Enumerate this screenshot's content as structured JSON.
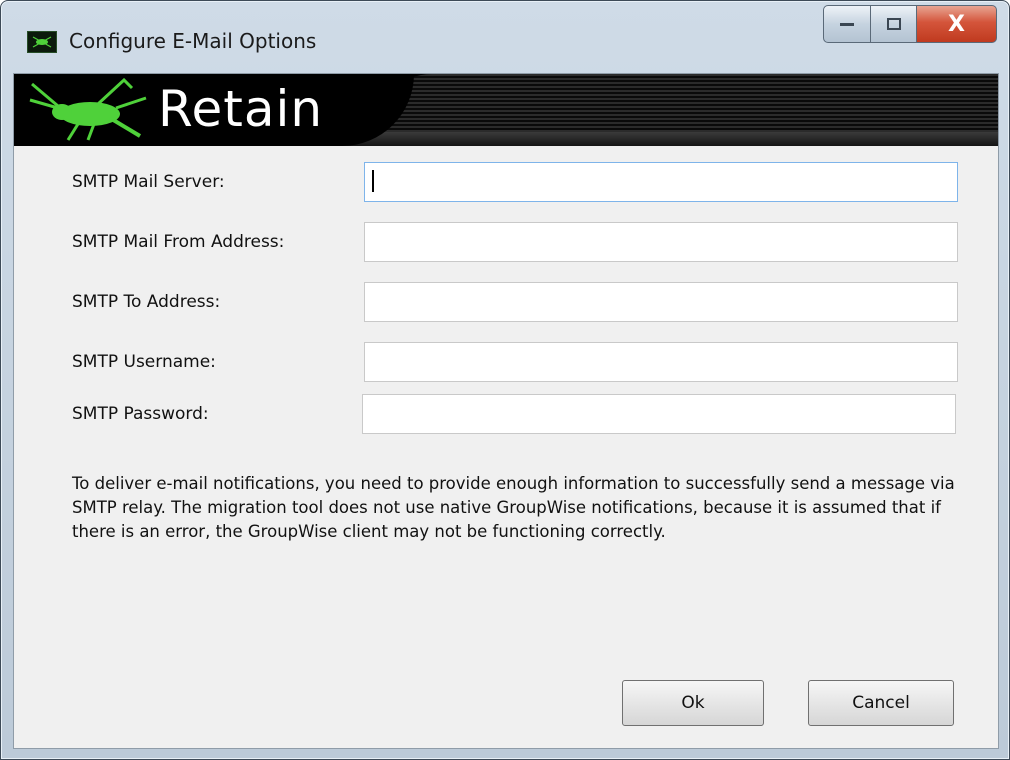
{
  "window": {
    "title": "Configure E-Mail Options",
    "controls": {
      "minimize_icon": "minimize-icon",
      "maximize_icon": "maximize-icon",
      "close_label": "X"
    }
  },
  "banner": {
    "brand": "Retain",
    "logo_icon": "cricket-icon",
    "accent_color": "#4fd13a"
  },
  "form": {
    "fields": [
      {
        "label": "SMTP Mail Server:",
        "value": "",
        "focused": true
      },
      {
        "label": "SMTP Mail From Address:",
        "value": ""
      },
      {
        "label": "SMTP To Address:",
        "value": ""
      },
      {
        "label": "SMTP Username:",
        "value": ""
      },
      {
        "label": "SMTP Password:",
        "value": ""
      }
    ]
  },
  "info": "To deliver e-mail notifications, you need to provide enough information to successfully send a message via SMTP relay. The migration tool does not use native GroupWise notifications, because it is assumed that if there is an error, the GroupWise client may not be functioning correctly.",
  "buttons": {
    "ok": "Ok",
    "cancel": "Cancel"
  }
}
